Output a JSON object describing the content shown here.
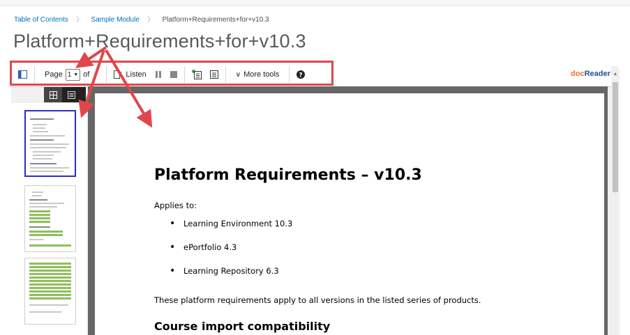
{
  "breadcrumb": {
    "items": [
      "Table of Contents",
      "Sample Module",
      "Platform+Requirements+for+v10.3"
    ]
  },
  "page_title": "Platform+Requirements+for+v10.3",
  "toolbar": {
    "page_label": "Page",
    "page_value": "1",
    "of_label": "of",
    "listen_label": "Listen",
    "more_tools_label": "More tools",
    "brand_doc": "doc",
    "brand_reader": "Reader"
  },
  "document": {
    "title": "Platform Requirements – v10.3",
    "applies": "Applies to:",
    "products": [
      "Learning Environment 10.3",
      "ePortfolio 4.3",
      "Learning Repository 6.3"
    ],
    "paragraph": "These platform requirements apply to all versions in the listed series of products.",
    "subheading": "Course import compatibility"
  },
  "colors": {
    "accent_link": "#006fbf",
    "annotation_red": "#e0464b",
    "selected_thumb": "#2c2cc8"
  },
  "icons": [
    "sidebar-toggle-icon",
    "dropdown-caret-icon",
    "listen-icon",
    "pause-icon",
    "stop-icon",
    "reading-mode-icon",
    "text-view-icon",
    "chevron-down-icon",
    "help-icon",
    "thumbnail-grid-icon",
    "list-view-icon"
  ]
}
